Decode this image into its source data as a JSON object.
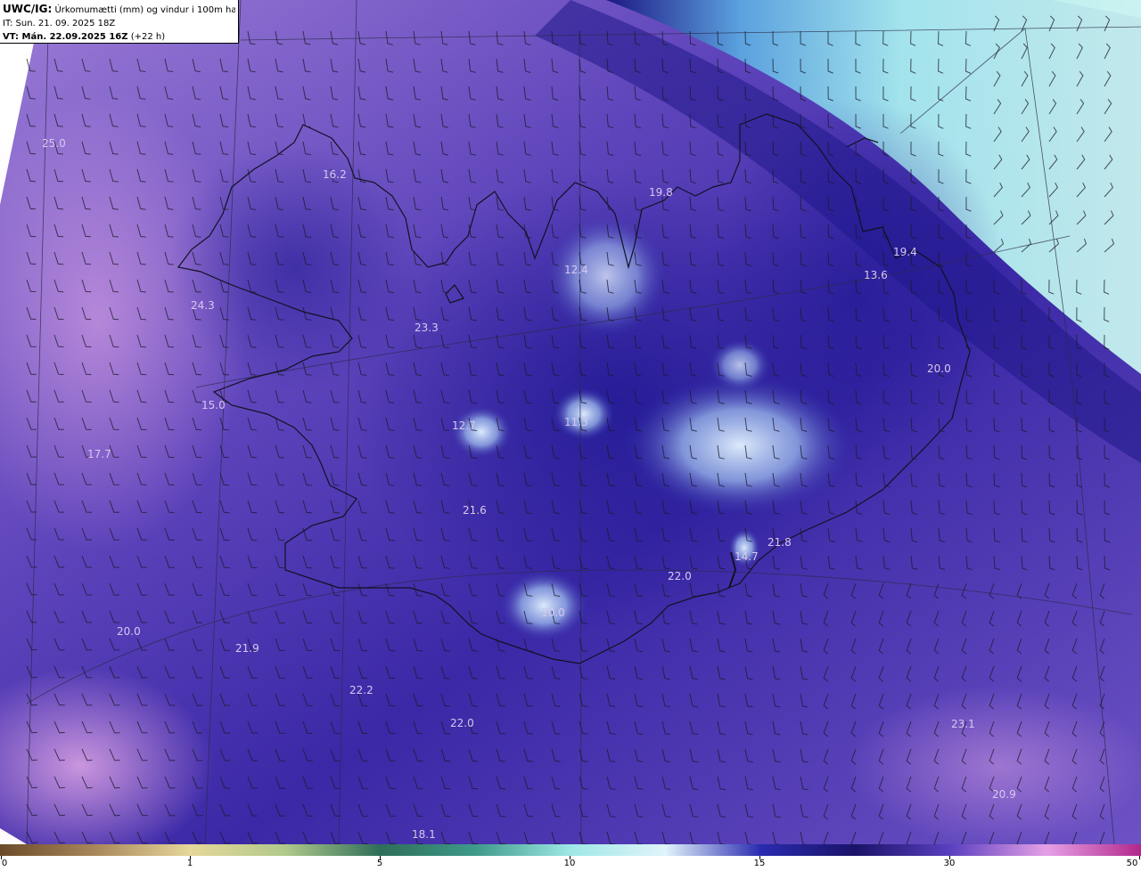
{
  "header": {
    "model": "UWC/IG:",
    "description": "Úrkomumætti (mm) og vindur i 100m hæð",
    "it_line": "IT: Sun. 21. 09. 2025 18Z",
    "vt_bold": "VT: Mán. 22.09.2025 16Z",
    "vt_offset": "(+22 h)"
  },
  "map_labels": [
    {
      "text": "25.0"
    },
    {
      "text": "16.2"
    },
    {
      "text": "19.8"
    },
    {
      "text": "19.4"
    },
    {
      "text": "13.6"
    },
    {
      "text": "12.4"
    },
    {
      "text": "24.3"
    },
    {
      "text": "23.3"
    },
    {
      "text": "20.0"
    },
    {
      "text": "15.0"
    },
    {
      "text": "12.7"
    },
    {
      "text": "11.3"
    },
    {
      "text": "17.7"
    },
    {
      "text": "21.6"
    },
    {
      "text": "21.8"
    },
    {
      "text": "14.7"
    },
    {
      "text": "22.0"
    },
    {
      "text": "10.0"
    },
    {
      "text": "20.0"
    },
    {
      "text": "21.9"
    },
    {
      "text": "22.2"
    },
    {
      "text": "22.0"
    },
    {
      "text": "23.1"
    },
    {
      "text": "20.9"
    },
    {
      "text": "18.1"
    }
  ],
  "colorbar": {
    "ticks": [
      "0",
      "1",
      "5",
      "10",
      "15",
      "30",
      "50"
    ],
    "colors": [
      "#6b4a2a",
      "#a8875a",
      "#e6d79a",
      "#b0c98a",
      "#2e6e5a",
      "#3e9a8a",
      "#9ee8e6",
      "#e0f4fb",
      "#2a2ab0",
      "#1a1468",
      "#5a3fc0",
      "#e6a0e6",
      "#b2288c"
    ]
  },
  "colors": {
    "ocean_purple": "#6a4ec0",
    "deep_blue": "#2a1d98",
    "light_blue": "#cdeefc",
    "pink": "#e4a8e4"
  }
}
